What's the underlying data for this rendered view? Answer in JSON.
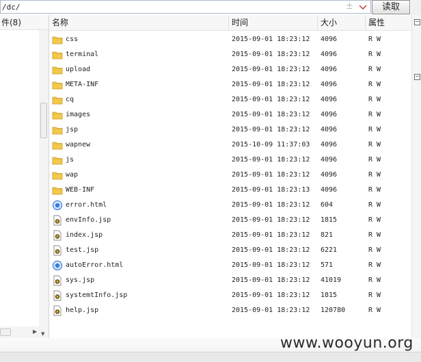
{
  "pathbar": {
    "path": "/dc/",
    "read_label": "读取"
  },
  "left_panel": {
    "header": "件(8)"
  },
  "columns": {
    "name": "名称",
    "time": "时间",
    "size": "大小",
    "attr": "属性"
  },
  "files": [
    {
      "type": "folder",
      "name": "css",
      "time": "2015-09-01 18:23:12",
      "size": "4096",
      "attr": "R W"
    },
    {
      "type": "folder",
      "name": "terminal",
      "time": "2015-09-01 18:23:12",
      "size": "4096",
      "attr": "R W"
    },
    {
      "type": "folder",
      "name": "upload",
      "time": "2015-09-01 18:23:12",
      "size": "4096",
      "attr": "R W"
    },
    {
      "type": "folder",
      "name": "META-INF",
      "time": "2015-09-01 18:23:12",
      "size": "4096",
      "attr": "R W"
    },
    {
      "type": "folder",
      "name": "cq",
      "time": "2015-09-01 18:23:12",
      "size": "4096",
      "attr": "R W"
    },
    {
      "type": "folder",
      "name": "images",
      "time": "2015-09-01 18:23:12",
      "size": "4096",
      "attr": "R W"
    },
    {
      "type": "folder",
      "name": "jsp",
      "time": "2015-09-01 18:23:12",
      "size": "4096",
      "attr": "R W"
    },
    {
      "type": "folder",
      "name": "wapnew",
      "time": "2015-10-09 11:37:03",
      "size": "4096",
      "attr": "R W"
    },
    {
      "type": "folder",
      "name": "js",
      "time": "2015-09-01 18:23:12",
      "size": "4096",
      "attr": "R W"
    },
    {
      "type": "folder",
      "name": "wap",
      "time": "2015-09-01 18:23:12",
      "size": "4096",
      "attr": "R W"
    },
    {
      "type": "folder",
      "name": "WEB-INF",
      "time": "2015-09-01 18:23:13",
      "size": "4096",
      "attr": "R W"
    },
    {
      "type": "html",
      "name": "error.html",
      "time": "2015-09-01 18:23:12",
      "size": "604",
      "attr": "R W"
    },
    {
      "type": "jsp",
      "name": "envInfo.jsp",
      "time": "2015-09-01 18:23:12",
      "size": "1815",
      "attr": "R W"
    },
    {
      "type": "jsp",
      "name": "index.jsp",
      "time": "2015-09-01 18:23:12",
      "size": "821",
      "attr": "R W"
    },
    {
      "type": "jsp",
      "name": "test.jsp",
      "time": "2015-09-01 18:23:12",
      "size": "6221",
      "attr": "R W"
    },
    {
      "type": "html",
      "name": "autoError.html",
      "time": "2015-09-01 18:23:12",
      "size": "571",
      "attr": "R W"
    },
    {
      "type": "jsp",
      "name": "sys.jsp",
      "time": "2015-09-01 18:23:12",
      "size": "41019",
      "attr": "R W"
    },
    {
      "type": "jsp",
      "name": "systemtInfo.jsp",
      "time": "2015-09-01 18:23:12",
      "size": "1815",
      "attr": "R W"
    },
    {
      "type": "jsp",
      "name": "help.jsp",
      "time": "2015-09-01 18:23:12",
      "size": "120780",
      "attr": "R W"
    }
  ],
  "icons": {
    "folder": "folder-icon",
    "html": "html-file-icon",
    "jsp": "jsp-file-icon",
    "plus": "plus-icon",
    "chevron": "chevron-down-icon"
  },
  "colors": {
    "folder": "#f2c94c",
    "html_globe": "#3a7bd5",
    "header_bg": "#f7f7f7"
  },
  "watermark": "www.wooyun.org"
}
